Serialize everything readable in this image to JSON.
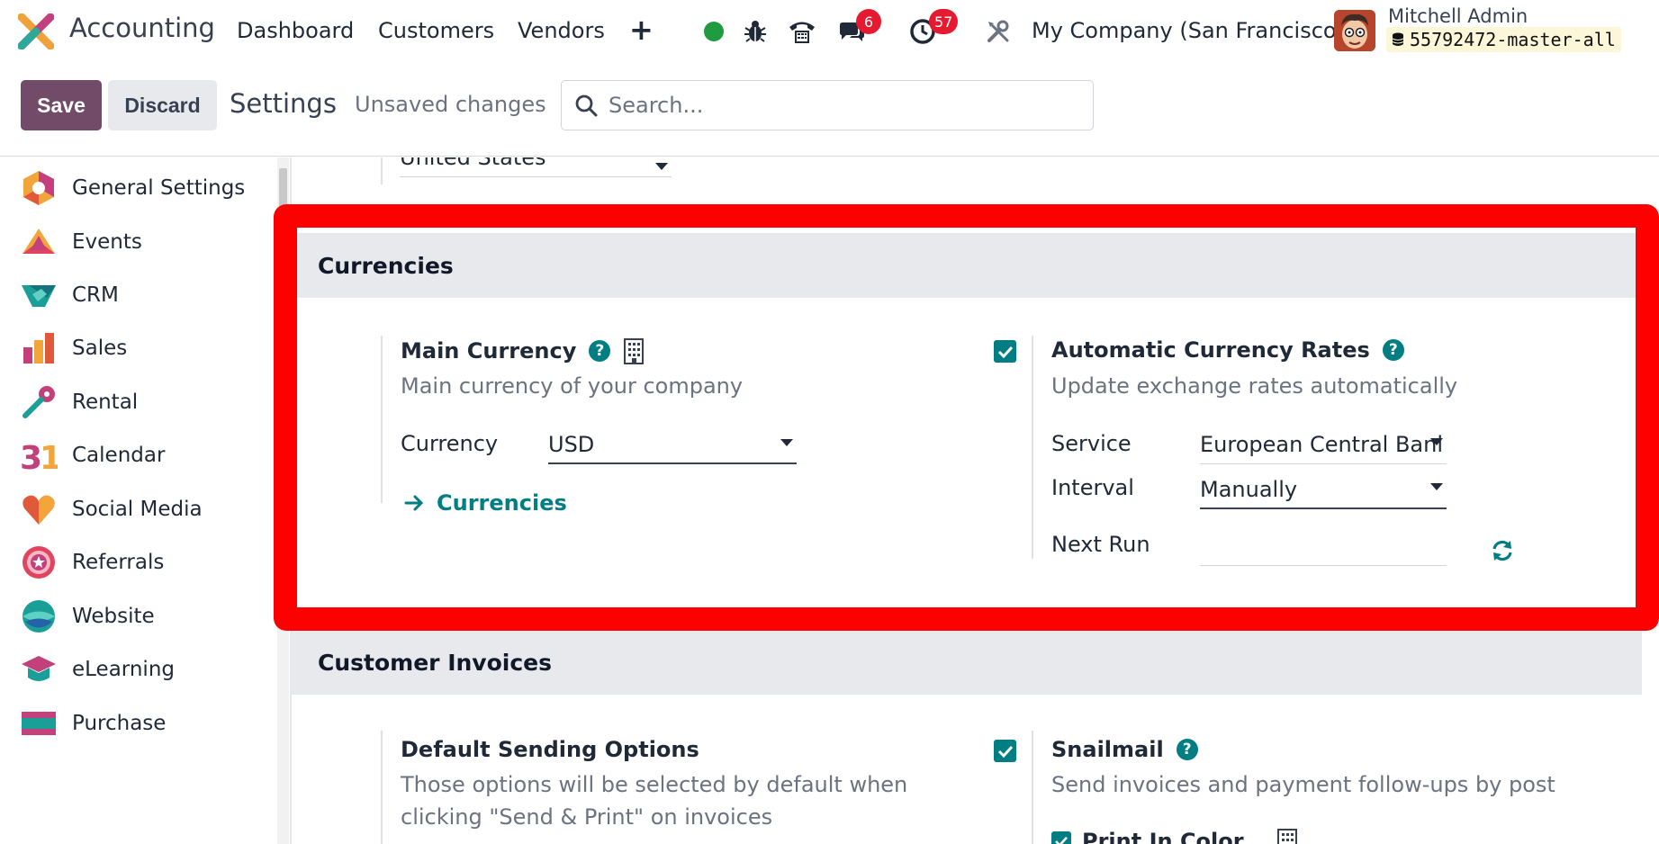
{
  "navbar": {
    "app_name": "Accounting",
    "menu": [
      "Dashboard",
      "Customers",
      "Vendors"
    ],
    "plus_label": "+",
    "chat_count": "6",
    "activity_count": "57",
    "company": "My Company (San Francisco)",
    "user_name": "Mitchell Admin",
    "database": "55792472-master-all",
    "status_color": "#1f9c3f",
    "brand_color": "#714b67"
  },
  "control": {
    "save_label": "Save",
    "discard_label": "Discard",
    "title": "Settings",
    "status": "Unsaved changes",
    "search_placeholder": "Search..."
  },
  "sidebar": {
    "items": [
      {
        "label": "General Settings",
        "icon": "general-settings-icon"
      },
      {
        "label": "Events",
        "icon": "events-icon"
      },
      {
        "label": "CRM",
        "icon": "crm-icon"
      },
      {
        "label": "Sales",
        "icon": "sales-icon"
      },
      {
        "label": "Rental",
        "icon": "rental-icon"
      },
      {
        "label": "Calendar",
        "icon": "calendar-icon"
      },
      {
        "label": "Social Media",
        "icon": "social-media-icon"
      },
      {
        "label": "Referrals",
        "icon": "referrals-icon"
      },
      {
        "label": "Website",
        "icon": "website-icon"
      },
      {
        "label": "eLearning",
        "icon": "elearning-icon"
      },
      {
        "label": "Purchase",
        "icon": "purchase-icon"
      }
    ]
  },
  "main": {
    "country_value": "United States",
    "currencies": {
      "heading": "Currencies",
      "main_currency": {
        "title": "Main Currency",
        "description": "Main currency of your company",
        "currency_label": "Currency",
        "currency_value": "USD",
        "link_label": "Currencies"
      },
      "automatic_rates": {
        "checked": true,
        "title": "Automatic Currency Rates",
        "description": "Update exchange rates automatically",
        "service_label": "Service",
        "service_value": "European Central Banl",
        "interval_label": "Interval",
        "interval_value": "Manually",
        "next_run_label": "Next Run",
        "next_run_value": ""
      }
    },
    "customer_invoices": {
      "heading": "Customer Invoices",
      "default_sending": {
        "checked": true,
        "title": "Default Sending Options",
        "description_line1": "Those options will be selected by default when",
        "description_line2": "clicking \"Send & Print\" on invoices"
      },
      "snailmail": {
        "title": "Snailmail",
        "description": "Send invoices and payment follow-ups by post",
        "print_in_color_label": "Print In Color",
        "print_in_color_checked": true
      }
    }
  },
  "accent_color": "#017e84",
  "highlight_color": "#ff0000"
}
